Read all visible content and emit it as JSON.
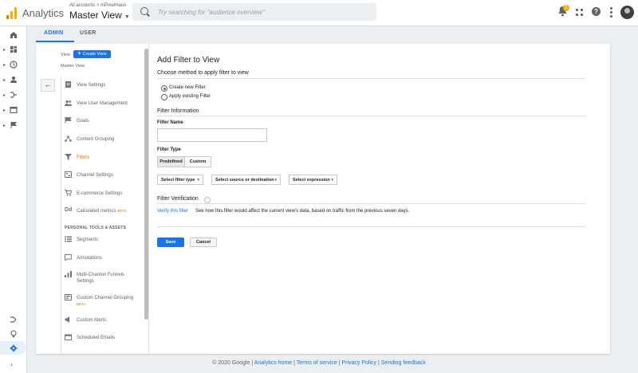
{
  "app": {
    "name": "Analytics"
  },
  "account": {
    "breadcrumb": "All accounts > mPixelHaus",
    "view": "Master View"
  },
  "search": {
    "placeholder": "Try searching for \"audience overview\""
  },
  "header_icons": {
    "notifications_count": "1"
  },
  "tabs": [
    {
      "label": "ADMIN",
      "active": true
    },
    {
      "label": "USER",
      "active": false
    }
  ],
  "view_panel": {
    "view_label": "View",
    "create_view": "Create View",
    "view_name": "Master View",
    "menu": [
      {
        "label": "View Settings",
        "icon": "document-icon"
      },
      {
        "label": "View User Management",
        "icon": "users-icon"
      },
      {
        "label": "Goals",
        "icon": "flag-icon"
      },
      {
        "label": "Content Grouping",
        "icon": "grouping-icon"
      },
      {
        "label": "Filters",
        "icon": "filter-icon",
        "active": true
      },
      {
        "label": "Channel Settings",
        "icon": "channel-icon"
      },
      {
        "label": "E-commerce Settings",
        "icon": "cart-icon"
      },
      {
        "label": "Calculated metrics",
        "icon": "dd-icon",
        "badge": "BETA"
      }
    ],
    "section_header": "PERSONAL TOOLS & ASSETS",
    "tools": [
      {
        "label": "Segments",
        "icon": "segments-icon"
      },
      {
        "label": "Annotations",
        "icon": "annotation-icon"
      },
      {
        "label": "Multi-Channel Funnels",
        "label2": "Settings",
        "icon": "funnel-icon"
      },
      {
        "label": "Custom Channel Grouping",
        "icon": "custom-grouping-icon",
        "badge": "BETA"
      },
      {
        "label": "Custom Alerts",
        "icon": "alert-icon"
      },
      {
        "label": "Scheduled Emails",
        "icon": "schedule-icon"
      }
    ]
  },
  "form": {
    "title": "Add Filter to View",
    "method_heading": "Choose method to apply filter to view",
    "option_create": "Create new Filter",
    "option_existing": "Apply existing Filter",
    "filter_info_heading": "Filter Information",
    "filter_name_label": "Filter Name",
    "filter_name_value": "",
    "filter_type_label": "Filter Type",
    "type_predefined": "Predefined",
    "type_custom": "Custom",
    "select_filter_type": "Select filter type",
    "select_source": "Select source or destination",
    "select_expression": "Select expression",
    "verification_heading": "Filter Verification",
    "verify_link": "Verify this filter",
    "verify_desc": "See how this filter would affect the current view's data, based on traffic from the previous seven days.",
    "save": "Save",
    "cancel": "Cancel"
  },
  "footer": {
    "copyright": "© 2020 Google",
    "links": [
      "Analytics home",
      "Terms of service",
      "Privacy Policy",
      "Sending feedback"
    ]
  },
  "colors": {
    "accent": "#1a73e8",
    "active_item": "#e8710a",
    "logo": "#f9ab00"
  }
}
